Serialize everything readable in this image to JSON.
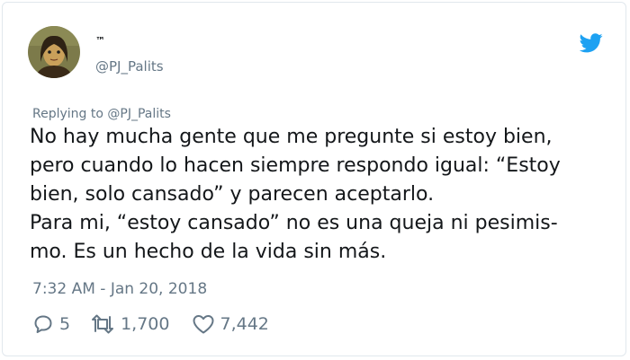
{
  "user": {
    "display_name": "™",
    "handle": "@PJ_Palits",
    "avatar_icon": "painted-portrait-avatar"
  },
  "reply": {
    "label": "Replying to @PJ_Palits"
  },
  "tweet": {
    "lines": [
      "No hay mucha gente que me pregunte si estoy bien,",
      "pero cuando lo hacen siempre respondo igual: “Estoy",
      "bien, solo cansado” y parecen aceptarlo.",
      "Para mi, “estoy cansado” no es una queja ni pesimis-",
      "mo. Es un hecho de la vida sin más."
    ],
    "timestamp": "7:32 AM - Jan 20, 2018"
  },
  "actions": {
    "replies": "5",
    "retweets": "1,700",
    "likes": "7,442"
  },
  "colors": {
    "accent": "#1da1f2",
    "secondary_text": "#657786",
    "primary_text": "#14171a"
  }
}
